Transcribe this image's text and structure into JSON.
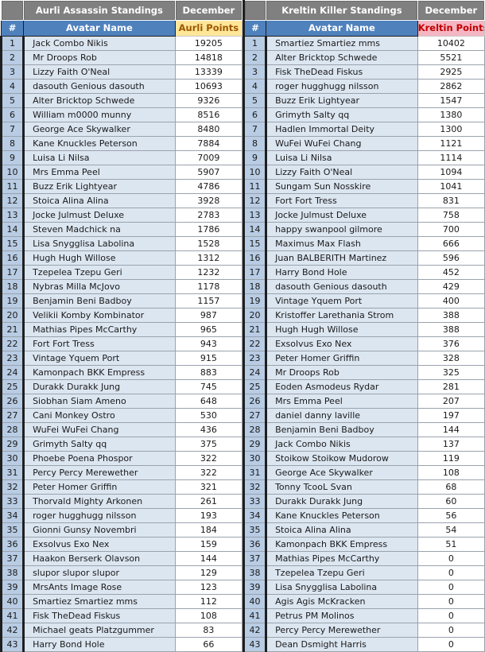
{
  "aurli": {
    "title": "Aurli Assassin Standings",
    "month": "December",
    "col_rank": "#",
    "col_name": "Avatar Name",
    "col_points": "Aurli Points",
    "points_header_color": "#ffe699",
    "rows": [
      {
        "rank": "1",
        "name": "Jack Combo Nikis",
        "points": "19205"
      },
      {
        "rank": "2",
        "name": "Mr Droops Rob",
        "points": "14818"
      },
      {
        "rank": "3",
        "name": "Lizzy Faith O'Neal",
        "points": "13339"
      },
      {
        "rank": "4",
        "name": "dasouth Genious dasouth",
        "points": "10693"
      },
      {
        "rank": "5",
        "name": "Alter Bricktop Schwede",
        "points": "9326"
      },
      {
        "rank": "6",
        "name": "William m0000 munny",
        "points": "8516"
      },
      {
        "rank": "7",
        "name": "George Ace Skywalker",
        "points": "8480"
      },
      {
        "rank": "8",
        "name": "Kane Knuckles Peterson",
        "points": "7884"
      },
      {
        "rank": "9",
        "name": "Luisa Li Nilsa",
        "points": "7009"
      },
      {
        "rank": "10",
        "name": "Mrs Emma Peel",
        "points": "5907"
      },
      {
        "rank": "11",
        "name": "Buzz Erik Lightyear",
        "points": "4786"
      },
      {
        "rank": "12",
        "name": "Stoica Alina Alina",
        "points": "3928"
      },
      {
        "rank": "13",
        "name": "Jocke Julmust Deluxe",
        "points": "2783"
      },
      {
        "rank": "14",
        "name": "Steven Madchick na",
        "points": "1786"
      },
      {
        "rank": "15",
        "name": "Lisa Snygglisa Labolina",
        "points": "1528"
      },
      {
        "rank": "16",
        "name": "Hugh Hugh Willose",
        "points": "1312"
      },
      {
        "rank": "17",
        "name": "Tzepelea Tzepu Geri",
        "points": "1232"
      },
      {
        "rank": "18",
        "name": "Nybras Milla McJovo",
        "points": "1178"
      },
      {
        "rank": "19",
        "name": "Benjamin Beni Badboy",
        "points": "1157"
      },
      {
        "rank": "20",
        "name": "Velikii Komby Kombinator",
        "points": "987"
      },
      {
        "rank": "21",
        "name": "Mathias Pipes McCarthy",
        "points": "965"
      },
      {
        "rank": "22",
        "name": "Fort Fort Tress",
        "points": "943"
      },
      {
        "rank": "23",
        "name": "Vintage Yquem Port",
        "points": "915"
      },
      {
        "rank": "24",
        "name": "Kamonpach BKK Empress",
        "points": "883"
      },
      {
        "rank": "25",
        "name": "Durakk Durakk Jung",
        "points": "745"
      },
      {
        "rank": "26",
        "name": "Siobhan Siam Ameno",
        "points": "648"
      },
      {
        "rank": "27",
        "name": "Cani Monkey Ostro",
        "points": "530"
      },
      {
        "rank": "28",
        "name": "WuFei WuFei Chang",
        "points": "436"
      },
      {
        "rank": "29",
        "name": "Grimyth Salty qq",
        "points": "375"
      },
      {
        "rank": "30",
        "name": "Phoebe Poena Phospor",
        "points": "322"
      },
      {
        "rank": "31",
        "name": "Percy Percy Merewether",
        "points": "322"
      },
      {
        "rank": "32",
        "name": "Peter Homer Griffin",
        "points": "321"
      },
      {
        "rank": "33",
        "name": "Thorvald Mighty Arkonen",
        "points": "261"
      },
      {
        "rank": "34",
        "name": "roger hugghugg nilsson",
        "points": "193"
      },
      {
        "rank": "35",
        "name": "Gionni Gunsy Novembri",
        "points": "184"
      },
      {
        "rank": "36",
        "name": "Exsolvus Exo Nex",
        "points": "159"
      },
      {
        "rank": "37",
        "name": "Haakon Berserk Olavson",
        "points": "144"
      },
      {
        "rank": "38",
        "name": "slupor slupor slupor",
        "points": "129"
      },
      {
        "rank": "39",
        "name": "MrsAnts Image Rose",
        "points": "123"
      },
      {
        "rank": "40",
        "name": "Smartiez Smartiez mms",
        "points": "112"
      },
      {
        "rank": "41",
        "name": "Fisk TheDead Fiskus",
        "points": "108"
      },
      {
        "rank": "42",
        "name": "Michael geats Platzgummer",
        "points": "83"
      },
      {
        "rank": "43",
        "name": "Harry Bond Hole",
        "points": "66"
      }
    ]
  },
  "kreltin": {
    "title": "Kreltin Killer Standings",
    "month": "December",
    "col_rank": "#",
    "col_name": "Avatar Name",
    "col_points": "Kreltin Points",
    "points_header_color": "#f4b6c2",
    "rows": [
      {
        "rank": "1",
        "name": "Smartiez Smartiez mms",
        "points": "10402"
      },
      {
        "rank": "2",
        "name": "Alter Bricktop Schwede",
        "points": "5521"
      },
      {
        "rank": "3",
        "name": "Fisk TheDead Fiskus",
        "points": "2925"
      },
      {
        "rank": "4",
        "name": "roger hugghugg nilsson",
        "points": "2862"
      },
      {
        "rank": "5",
        "name": "Buzz Erik Lightyear",
        "points": "1547"
      },
      {
        "rank": "6",
        "name": "Grimyth Salty qq",
        "points": "1380"
      },
      {
        "rank": "7",
        "name": "Hadlen Immortal Deity",
        "points": "1300"
      },
      {
        "rank": "8",
        "name": "WuFei WuFei Chang",
        "points": "1121"
      },
      {
        "rank": "9",
        "name": "Luisa Li Nilsa",
        "points": "1114"
      },
      {
        "rank": "10",
        "name": "Lizzy Faith O'Neal",
        "points": "1094"
      },
      {
        "rank": "11",
        "name": "Sungam Sun Nosskire",
        "points": "1041"
      },
      {
        "rank": "12",
        "name": "Fort Fort Tress",
        "points": "831"
      },
      {
        "rank": "13",
        "name": "Jocke Julmust Deluxe",
        "points": "758"
      },
      {
        "rank": "14",
        "name": "happy swanpool gilmore",
        "points": "700"
      },
      {
        "rank": "15",
        "name": "Maximus Max Flash",
        "points": "666"
      },
      {
        "rank": "16",
        "name": "Juan BALBERITH Martinez",
        "points": "596"
      },
      {
        "rank": "17",
        "name": "Harry Bond Hole",
        "points": "452"
      },
      {
        "rank": "18",
        "name": "dasouth Genious dasouth",
        "points": "429"
      },
      {
        "rank": "19",
        "name": "Vintage Yquem Port",
        "points": "400"
      },
      {
        "rank": "20",
        "name": "Kristoffer Larethania Strom",
        "points": "388"
      },
      {
        "rank": "21",
        "name": "Hugh Hugh Willose",
        "points": "388"
      },
      {
        "rank": "22",
        "name": "Exsolvus Exo Nex",
        "points": "376"
      },
      {
        "rank": "23",
        "name": "Peter Homer Griffin",
        "points": "328"
      },
      {
        "rank": "24",
        "name": "Mr Droops Rob",
        "points": "325"
      },
      {
        "rank": "25",
        "name": "Eoden Asmodeus Rydar",
        "points": "281"
      },
      {
        "rank": "26",
        "name": "Mrs Emma Peel",
        "points": "207"
      },
      {
        "rank": "27",
        "name": "daniel danny laville",
        "points": "197"
      },
      {
        "rank": "28",
        "name": "Benjamin Beni Badboy",
        "points": "144"
      },
      {
        "rank": "29",
        "name": "Jack Combo Nikis",
        "points": "137"
      },
      {
        "rank": "30",
        "name": "Stoikow Stoikow Mudorow",
        "points": "119"
      },
      {
        "rank": "31",
        "name": "George Ace Skywalker",
        "points": "108"
      },
      {
        "rank": "32",
        "name": "Tonny TcooL Svan",
        "points": "68"
      },
      {
        "rank": "33",
        "name": "Durakk Durakk Jung",
        "points": "60"
      },
      {
        "rank": "34",
        "name": "Kane Knuckles Peterson",
        "points": "56"
      },
      {
        "rank": "35",
        "name": "Stoica Alina Alina",
        "points": "54"
      },
      {
        "rank": "36",
        "name": "Kamonpach BKK Empress",
        "points": "51"
      },
      {
        "rank": "37",
        "name": "Mathias Pipes McCarthy",
        "points": "0"
      },
      {
        "rank": "38",
        "name": "Tzepelea Tzepu Geri",
        "points": "0"
      },
      {
        "rank": "39",
        "name": "Lisa Snygglisa Labolina",
        "points": "0"
      },
      {
        "rank": "40",
        "name": "Agis Agis McKracken",
        "points": "0"
      },
      {
        "rank": "41",
        "name": "Petrus PM Molinos",
        "points": "0"
      },
      {
        "rank": "42",
        "name": "Percy Percy Merewether",
        "points": "0"
      },
      {
        "rank": "43",
        "name": "Dean Dsmight Harris",
        "points": "0"
      }
    ]
  }
}
